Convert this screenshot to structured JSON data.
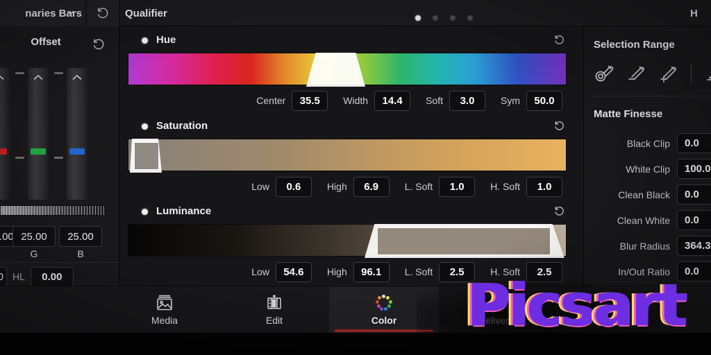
{
  "topbar": {
    "node_title": "naries Bars",
    "panel_title": "Qualifier",
    "right_label": "H",
    "dots": [
      true,
      false,
      false,
      false
    ],
    "reset_icon": "reset-icon",
    "chevron_icon": "chevron-down-icon"
  },
  "left_panel": {
    "title": "Offset",
    "reset_icon": "reset-icon",
    "fields": [
      {
        "label": "G",
        "value": "25.00"
      },
      {
        "label": "B",
        "value": "25.00"
      }
    ],
    "partial_field_value": "0",
    "hl_label": "HL",
    "hl_value": "0.00",
    "slider_colors": [
      "#cc2222",
      "#22aa44",
      "#2266cc"
    ]
  },
  "qualifier": {
    "sections": [
      {
        "name": "Hue",
        "enabled": true,
        "reset_icon": "reset-icon",
        "selection": {
          "start_pct": 41.5,
          "end_pct": 54.5
        },
        "params": [
          {
            "label": "Center",
            "value": "35.5"
          },
          {
            "label": "Width",
            "value": "14.4"
          },
          {
            "label": "Soft",
            "value": "3.0"
          },
          {
            "label": "Sym",
            "value": "50.0"
          }
        ]
      },
      {
        "name": "Saturation",
        "enabled": true,
        "reset_icon": "reset-icon",
        "selection": {
          "start_pct": 0.5,
          "end_pct": 7.5
        },
        "params": [
          {
            "label": "Low",
            "value": "0.6"
          },
          {
            "label": "High",
            "value": "6.9"
          },
          {
            "label": "L. Soft",
            "value": "1.0"
          },
          {
            "label": "H. Soft",
            "value": "1.0"
          }
        ]
      },
      {
        "name": "Luminance",
        "enabled": true,
        "reset_icon": "reset-icon",
        "selection": {
          "start_pct": 54.6,
          "end_pct": 96.1
        },
        "params": [
          {
            "label": "Low",
            "value": "54.6"
          },
          {
            "label": "High",
            "value": "96.1"
          },
          {
            "label": "L. Soft",
            "value": "2.5"
          },
          {
            "label": "H. Soft",
            "value": "2.5"
          }
        ]
      }
    ]
  },
  "right_panel": {
    "selection_range_title": "Selection Range",
    "pickers": [
      "eyedropper-picker-icon",
      "eyedropper-minus-icon",
      "eyedropper-plus-icon",
      "softness-minus-icon"
    ],
    "matte_finesse_title": "Matte Finesse",
    "matte_finesse": [
      {
        "label": "Black Clip",
        "value": "0.0"
      },
      {
        "label": "White Clip",
        "value": "100.0"
      },
      {
        "label": "Clean Black",
        "value": "0.0"
      },
      {
        "label": "Clean White",
        "value": "0.0"
      },
      {
        "label": "Blur Radius",
        "value": "364.3"
      },
      {
        "label": "In/Out Ratio",
        "value": "0.0"
      }
    ]
  },
  "bottom_nav": {
    "items": [
      {
        "label": "Media",
        "icon": "media-icon",
        "active": false
      },
      {
        "label": "Edit",
        "icon": "edit-icon",
        "active": false
      },
      {
        "label": "Color",
        "icon": "color-icon",
        "active": true
      },
      {
        "label": "Deliver",
        "icon": "deliver-icon",
        "active": false
      }
    ],
    "active_underline_color": "#d03030"
  },
  "watermark": {
    "text": "Picsart"
  }
}
